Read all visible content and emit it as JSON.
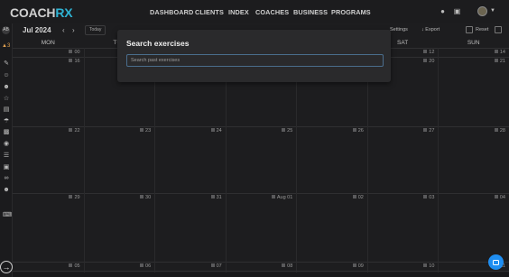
{
  "brand": {
    "coach": "COACH",
    "rx": "RX"
  },
  "nav": [
    "DASHBOARD",
    "CLIENTS",
    "INDEX",
    "COACHES",
    "BUSINESS",
    "PROGRAMS"
  ],
  "rail": {
    "badge": "AB",
    "counter": "3"
  },
  "toolbar": {
    "month": "Jul 2024",
    "today": "Today",
    "settings": "Settings",
    "export": "Export",
    "reset": "Reset"
  },
  "days": [
    "MON",
    "TUE",
    "WED",
    "THU",
    "FRI",
    "SAT",
    "SUN"
  ],
  "weeks": [
    [
      "00",
      "",
      "",
      "",
      "",
      "12",
      "14"
    ],
    [
      "16",
      "",
      "",
      "",
      "",
      "20",
      "21"
    ],
    [
      "22",
      "23",
      "24",
      "25",
      "26",
      "27",
      "28"
    ],
    [
      "29",
      "30",
      "31",
      "Aug 01",
      "02",
      "03",
      "04"
    ],
    [
      "05",
      "06",
      "07",
      "08",
      "09",
      "10",
      "11"
    ]
  ],
  "modal": {
    "title": "Search exercises",
    "placeholder": "Search past exercises"
  }
}
